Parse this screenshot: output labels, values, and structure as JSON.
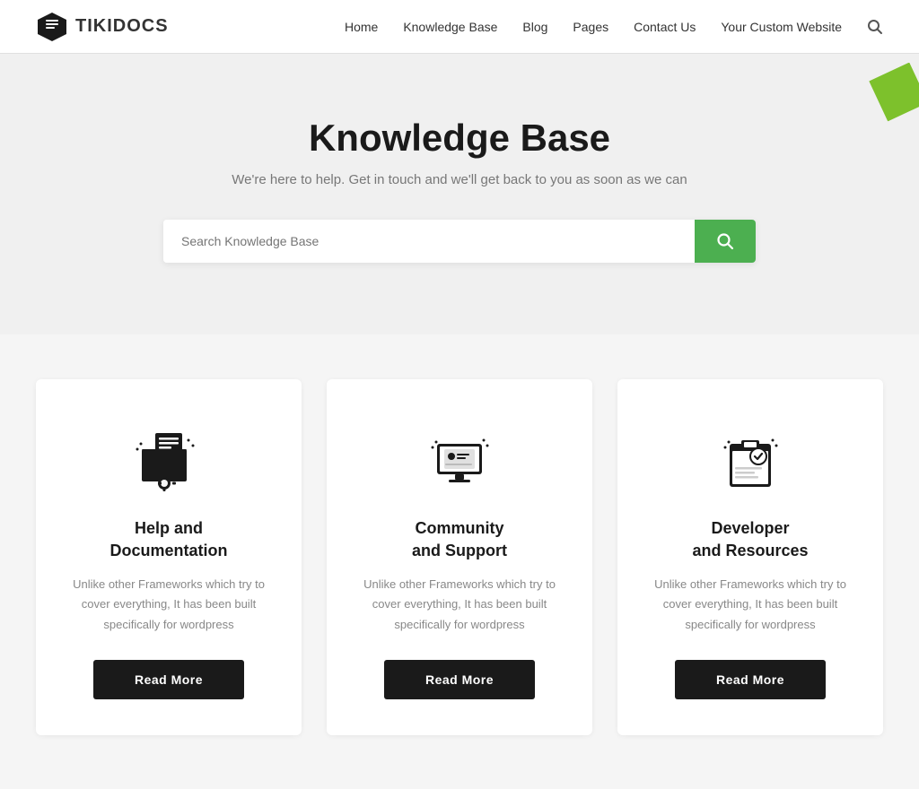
{
  "header": {
    "logo_text": "TIKIDOCS",
    "nav_items": [
      "Home",
      "Knowledge Base",
      "Blog",
      "Pages",
      "Contact Us",
      "Your Custom Website"
    ]
  },
  "hero": {
    "title": "Knowledge Base",
    "subtitle": "We're here to help. Get in touch and we'll get back to you as soon as we can",
    "search_placeholder": "Search Knowledge Base",
    "search_button_label": "🔍"
  },
  "cards": [
    {
      "icon": "help-doc-icon",
      "title": "Help and\nDocumentation",
      "description": "Unlike other Frameworks which try to cover everything, It has been built specifically for wordpress",
      "button_label": "Read More"
    },
    {
      "icon": "community-icon",
      "title": "Community\nand Support",
      "description": "Unlike other Frameworks which try to cover everything, It has been built specifically for wordpress",
      "button_label": "Read More"
    },
    {
      "icon": "developer-icon",
      "title": "Developer\nand Resources",
      "description": "Unlike other Frameworks which try to cover everything, It has been built specifically for wordpress",
      "button_label": "Read More"
    }
  ]
}
